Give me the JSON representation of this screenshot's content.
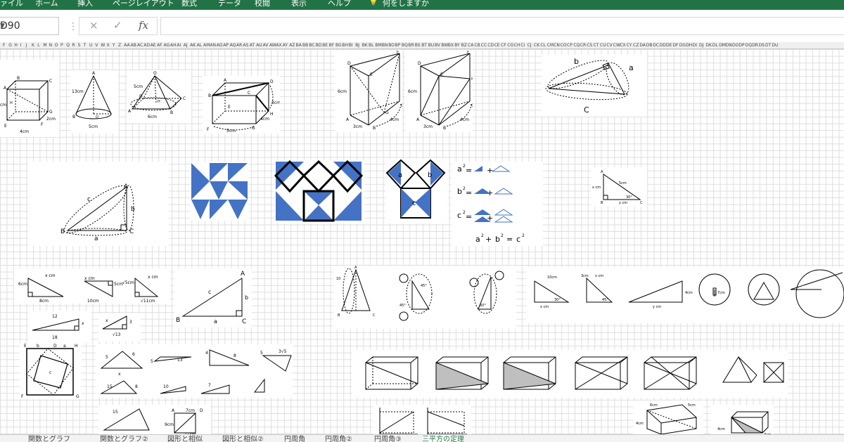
{
  "ribbon": {
    "tabs": [
      "ァイル",
      "ホーム",
      "挿入",
      "ページレイアウト",
      "数式",
      "データ",
      "校閲",
      "表示",
      "ヘルプ",
      "何をしますか"
    ],
    "tell_me_icon": "lightbulb-icon"
  },
  "formula_bar": {
    "name_box": "D90",
    "cancel_icon": "×",
    "confirm_icon": "✓",
    "fx_label": "fx",
    "value": ""
  },
  "columns": [
    "F",
    "G",
    "H",
    "I",
    "J",
    "K",
    "L",
    "M",
    "N",
    "O",
    "P",
    "Q",
    "R",
    "S",
    "T",
    "U",
    "V",
    "W",
    "X",
    "Y",
    "Z",
    "AA",
    "AB",
    "AC",
    "AD",
    "AE",
    "AF",
    "AG",
    "AH",
    "AI",
    "AJ",
    "AK",
    "AL",
    "AM",
    "AN",
    "AO",
    "AP",
    "AQ",
    "AR",
    "AS",
    "AT",
    "AU",
    "AV",
    "AW",
    "AX",
    "AY",
    "AZ",
    "BA",
    "BB",
    "BC",
    "BD",
    "BE",
    "BF",
    "BG",
    "BH",
    "BI",
    "BJ",
    "BK",
    "BL",
    "BM",
    "BN",
    "BO",
    "BP",
    "BQ",
    "BR",
    "BS",
    "BT",
    "BU",
    "BV",
    "BW",
    "BX",
    "BY",
    "BZ",
    "CA",
    "CB",
    "CC",
    "CD",
    "CE",
    "CF",
    "CG",
    "CH",
    "CI",
    "CJ",
    "CK",
    "CL",
    "CM",
    "CN",
    "CO",
    "CP",
    "CQ",
    "CR",
    "CS",
    "CT",
    "CU",
    "CV",
    "CW",
    "CX",
    "CY",
    "CZ",
    "DA",
    "DB",
    "DC",
    "DD",
    "DE",
    "DF",
    "DG",
    "DH",
    "DI",
    "DJ",
    "DK",
    "DL",
    "DM",
    "DN",
    "DO",
    "DP",
    "DQ",
    "DR",
    "DS",
    "DT",
    "DU"
  ],
  "figures": {
    "cube": {
      "A": "A",
      "B": "B",
      "C": "C",
      "E": "E",
      "F": "F",
      "G": "G",
      "H": "H",
      "len_cm": "cm",
      "len_4": "4cm",
      "len_2": "2cm"
    },
    "cone": {
      "A": "A",
      "B": "B",
      "O": "O",
      "slant": "13cm",
      "radius": "5cm"
    },
    "pyramid": {
      "O": "O",
      "A": "A",
      "B": "B",
      "C": "C",
      "D": "D",
      "H": "H",
      "edge": "5cm",
      "base": "6cm"
    },
    "box": {
      "A": "A",
      "B": "B",
      "C": "C",
      "D": "D",
      "E": "E",
      "F": "F",
      "G": "G",
      "H": "H",
      "l3": "3cm",
      "l4": "4cm",
      "l5": "5cm"
    },
    "prism1": {
      "D": "D",
      "E": "E",
      "F": "F",
      "A": "A",
      "B": "B",
      "C": "C",
      "G": "G",
      "h": "6cm",
      "w": "3cm",
      "d": "4cm"
    },
    "prism2": {
      "D": "D",
      "E": "E",
      "F": "F",
      "H": "H",
      "A": "A",
      "B": "B",
      "C": "C",
      "h": "6cm",
      "w": "3cm",
      "d": "4cm"
    },
    "triangle_abc_top": {
      "a": "a",
      "b": "b",
      "c": "C"
    },
    "triangle_abc_left": {
      "A": "A",
      "B": "B",
      "C": "C",
      "a": "a",
      "b": "b",
      "c": "c"
    },
    "pythagoras": {
      "a2": "a",
      "b2": "b",
      "c2": "c",
      "sq": "2",
      "eq": "=",
      "plus": "+",
      "final_a": "a",
      "final_b": "b",
      "final_c": "c"
    },
    "small_tri": {
      "A": "A",
      "B": "B",
      "C": "C",
      "h": "x cm",
      "len": "5cm",
      "ang": "30°",
      "base": "y cm"
    },
    "row_tris": {
      "t1_top": "x cm",
      "t1_left": "6cm",
      "t1_bottom": "8cm",
      "t2_top": "x cm",
      "t2_right": "5cm",
      "t2_bottom": "10cm",
      "t3_left": "√5cm",
      "t3_top": "x cm",
      "t3_bottom": "√11cm"
    },
    "tri_12": {
      "l12": "12",
      "x": "x",
      "l18": "18"
    },
    "tri_3": {
      "x": "x",
      "l3": "3",
      "r13": "√13"
    },
    "big_abc": {
      "A": "A",
      "B": "B",
      "C": "C",
      "a": "a",
      "b": "b",
      "c": "c"
    },
    "square_proof": {
      "E": "E",
      "b": "b",
      "D": "D",
      "a": "a",
      "H": "H",
      "F": "F",
      "G": "G",
      "c": "c"
    },
    "mini_tris": {
      "n5": "5",
      "n6": "6",
      "n8": "8",
      "n4": "4",
      "n10": "10",
      "n7": "7",
      "n15": "15",
      "n13": "13",
      "r3": "3√5",
      "x": "x"
    },
    "rect_tri": {
      "A": "A",
      "D": "D",
      "len7": "7cm",
      "len9": "9cm",
      "len11": "11cm"
    },
    "row2": {
      "n10": "10",
      "A": "A",
      "B": "B",
      "C": "C",
      "a60": "60°",
      "a45": "45°",
      "l10cm": "10cm",
      "l3cm": "3cm",
      "xcm": "x cm",
      "ycm": "y cm",
      "l4cm": "4cm",
      "a30": "30°",
      "a45b": "45°",
      "r7cm": "7cm"
    },
    "boxes": {
      "A": "A",
      "B": "B",
      "C": "C",
      "D": "D",
      "E": "E",
      "F": "F",
      "G": "G",
      "H": "H",
      "l6": "6cm",
      "l5": "5cm",
      "l4": "4cm",
      "l3": "3cm"
    }
  },
  "sheet_tabs": [
    "...",
    "関数とグラフ",
    "関数とグラフ②",
    "図形と相似",
    "図形と相似②",
    "円周角",
    "円周角②",
    "円周角③",
    "三平方の定理"
  ],
  "active_sheet": "三平方の定理"
}
